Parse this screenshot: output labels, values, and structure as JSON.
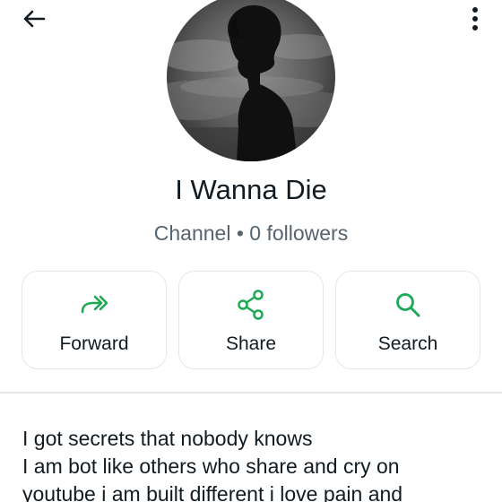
{
  "header": {
    "back_icon": "arrow-left-icon",
    "menu_icon": "more-vertical-icon"
  },
  "channel": {
    "name": "I Wanna Die",
    "subtitle": "Channel • 0 followers"
  },
  "actions": [
    {
      "label": "Forward",
      "icon": "forward-icon"
    },
    {
      "label": "Share",
      "icon": "share-icon"
    },
    {
      "label": "Search",
      "icon": "search-icon"
    }
  ],
  "description": {
    "lines": [
      "I got secrets that nobody knows",
      "I am bot like others who share and cry on",
      "youtube i am built different i love pain and"
    ]
  },
  "colors": {
    "accent": "#1fa855",
    "text": "#111b21",
    "secondary_text": "#54656f",
    "border": "#e4e7e9"
  }
}
